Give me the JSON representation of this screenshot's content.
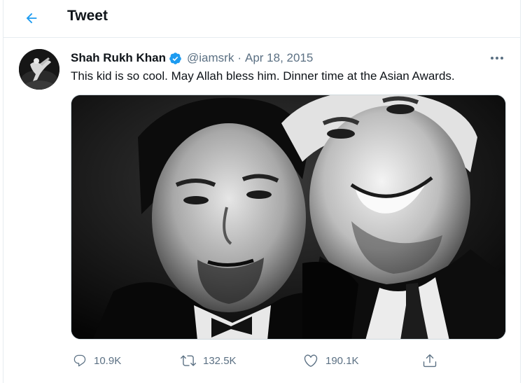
{
  "header": {
    "title": "Tweet",
    "back_icon": "arrow-left-icon"
  },
  "colors": {
    "accent": "#1d9bf0",
    "secondary_text": "#5b7083",
    "primary_text": "#0f1419",
    "border": "#e6ecf0"
  },
  "tweet": {
    "author_name": "Shah Rukh Khan",
    "verified": true,
    "handle": "@iamsrk",
    "separator": "·",
    "date": "Apr 18, 2015",
    "text": "This kid is so cool. May Allah bless him. Dinner time at the Asian Awards.",
    "more_icon": "more-horizontal-icon",
    "media_type": "black-and-white photo"
  },
  "actions": {
    "reply": {
      "icon": "reply-icon",
      "count": "10.9K"
    },
    "retweet": {
      "icon": "retweet-icon",
      "count": "132.5K"
    },
    "like": {
      "icon": "heart-icon",
      "count": "190.1K"
    },
    "share": {
      "icon": "share-icon"
    }
  }
}
